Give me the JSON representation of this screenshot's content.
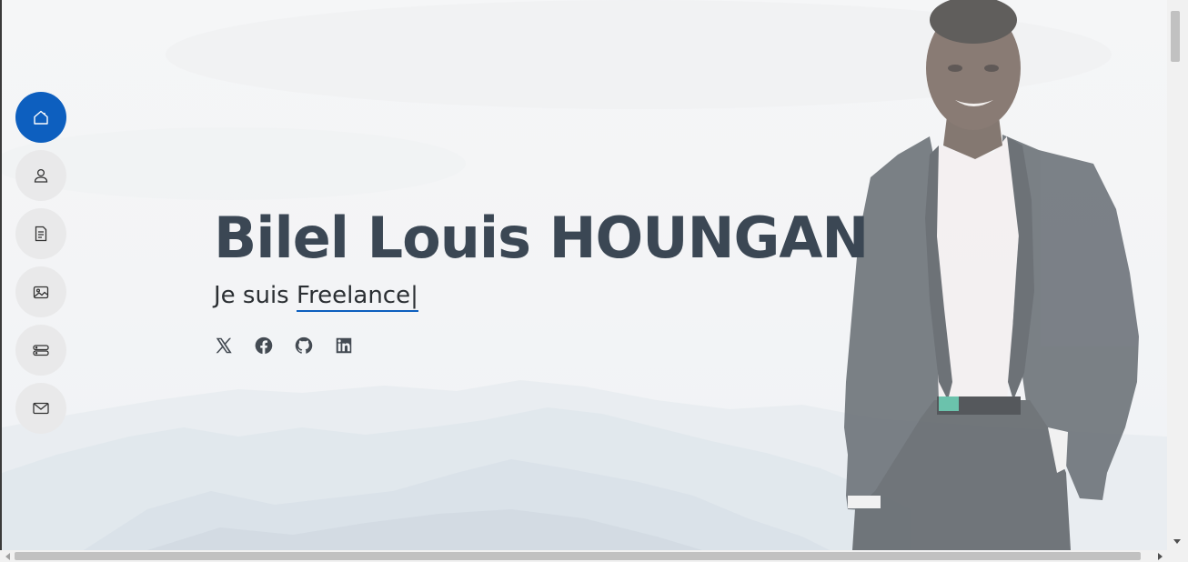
{
  "hero": {
    "name": "Bilel Louis HOUNGAN",
    "subtitle_prefix": "Je suis",
    "typed_text": "Freelance",
    "cursor": "|"
  },
  "nav": {
    "items": [
      {
        "name": "home",
        "icon": "house-icon",
        "active": true
      },
      {
        "name": "about",
        "icon": "person-icon",
        "active": false
      },
      {
        "name": "resume",
        "icon": "document-icon",
        "active": false
      },
      {
        "name": "portfolio",
        "icon": "images-icon",
        "active": false
      },
      {
        "name": "services",
        "icon": "server-icon",
        "active": false
      },
      {
        "name": "contact",
        "icon": "envelope-icon",
        "active": false
      }
    ]
  },
  "socials": [
    {
      "name": "twitter-x",
      "icon": "x-twitter-icon"
    },
    {
      "name": "facebook",
      "icon": "facebook-icon"
    },
    {
      "name": "github",
      "icon": "github-icon"
    },
    {
      "name": "linkedin",
      "icon": "linkedin-icon"
    }
  ],
  "colors": {
    "accent": "#0d5fbf",
    "title": "#3b4754",
    "nav_bg": "#e9e9ea"
  }
}
